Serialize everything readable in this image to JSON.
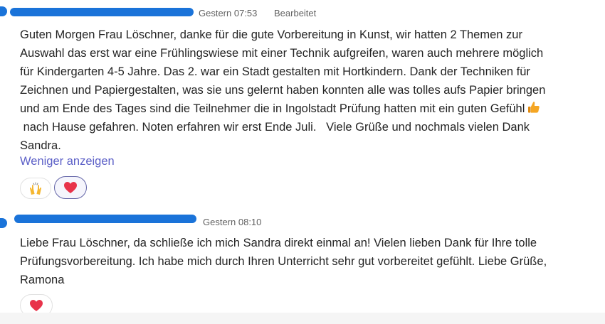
{
  "messages": [
    {
      "timestamp": "Gestern 07:53",
      "edited_label": "Bearbeitet",
      "lines": [
        "Guten Morgen Frau Löschner, danke für die gute Vorbereitung in Kunst, wir hatten 2 Themen zur",
        "Auswahl das erst war eine Frühlingswiese mit einer Technik aufgreifen, waren auch mehrere möglich",
        "für Kindergarten 4-5 Jahre. Das 2. war ein Stadt gestalten mit Hortkindern. Dank der Techniken für",
        "Zeichnen und Papiergestalten, was sie uns gelernt haben konnten alle was tolles aufs Papier bringen",
        "und am Ende des Tages sind die Teilnehmer die in Ingolstadt Prüfung hatten mit ein guten Gefühl",
        " nach Hause gefahren. Noten erfahren wir erst Ende Juli.   Viele Grüße und nochmals vielen Dank",
        "Sandra."
      ],
      "inline_emoji": "thumbs-up-icon",
      "show_less_label": "Weniger anzeigen",
      "reactions": [
        "raising-hands-icon",
        "heart-icon"
      ]
    },
    {
      "timestamp": "Gestern 08:10",
      "lines": [
        "Liebe Frau Löschner, da schließe ich mich Sandra direkt einmal an! Vielen lieben Dank für Ihre tolle",
        "Prüfungsvorbereitung. Ich habe mich durch Ihren Unterricht sehr gut vorbereitet gefühlt. Liebe Grüße,",
        "Ramona"
      ],
      "reactions": [
        "heart-icon"
      ]
    }
  ],
  "colors": {
    "accent": "#5b5fc7",
    "redaction": "#1a73d9",
    "heart": "#e8334a",
    "meta_text": "#616161"
  }
}
